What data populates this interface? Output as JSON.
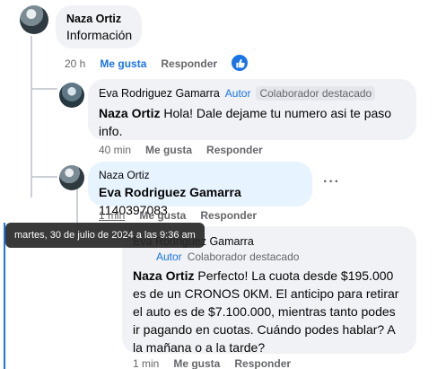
{
  "comments": [
    {
      "author": "Naza Ortiz",
      "text": "Información",
      "time": "20 h",
      "like_label": "Me gusta",
      "reply_label": "Responder"
    },
    {
      "author": "Eva Rodriguez Gamarra",
      "badge_author": "Autor",
      "badge_featured": "Colaborador destacado",
      "mention": "Naza Ortiz",
      "text": "Hola! Dale dejame tu numero asi te paso info.",
      "time": "40 min",
      "like_label": "Me gusta",
      "reply_label": "Responder"
    },
    {
      "author": "Naza Ortiz",
      "mention": "Eva Rodriguez Gamarra",
      "text": "1140397083",
      "time": "1 min",
      "like_label": "Me gusta",
      "reply_label": "Responder"
    },
    {
      "author": "Eva Rodriguez Gamarra",
      "badge_author": "Autor",
      "badge_featured": "Colaborador destacado",
      "mention": "Naza Ortiz",
      "text": "Perfecto! La cuota desde $195.000 es de un CRONOS 0KM. El anticipo para retirar el auto es de $7.100.000, mientras tanto podes ir pagando en cuotas. Cuándo podes hablar? A la mañana o a la tarde?",
      "time": "1 min",
      "like_label": "Me gusta",
      "reply_label": "Responder"
    }
  ],
  "tooltip": "martes, 30 de julio de 2024 a las 9:36 am",
  "more_options": "···",
  "colors": {
    "accent": "#1b74e4",
    "bubble_gray": "#f0f2f5",
    "bubble_highlight": "#e7f3ff",
    "thread_line": "#ccd0d5"
  }
}
